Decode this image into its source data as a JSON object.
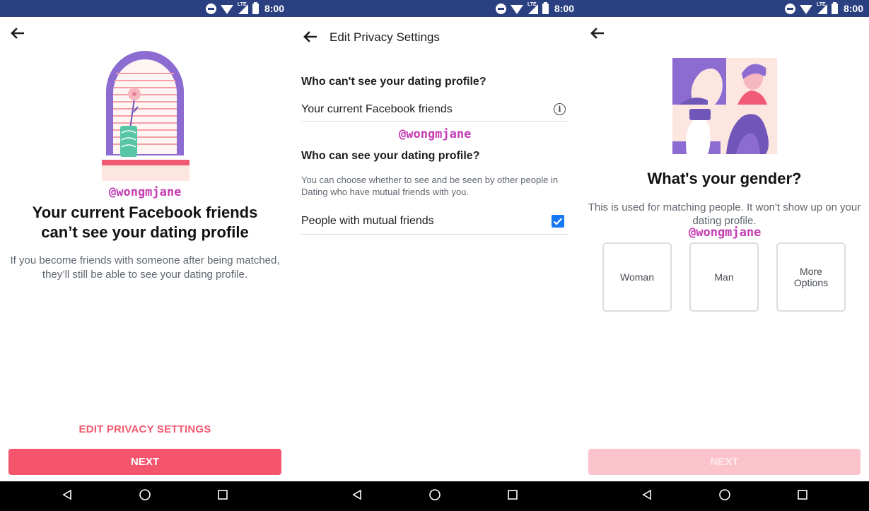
{
  "status_bar": {
    "time": "8:00",
    "network": "LTE"
  },
  "screen1": {
    "headline_line1": "Your current Facebook friends",
    "headline_line2": "can’t see your dating profile",
    "subtext": "If you become friends with someone after being matched, they’ll still be able to see your dating profile.",
    "edit_link": "EDIT PRIVACY SETTINGS",
    "next_button": "NEXT",
    "watermark": "@wongmjane"
  },
  "screen2": {
    "title": "Edit Privacy Settings",
    "section1_heading": "Who can't see your dating profile?",
    "section1_row": "Your current Facebook friends",
    "section2_heading": "Who can see your dating profile?",
    "section2_desc": "You can choose whether to see and be seen by other people in Dating who have mutual friends with you.",
    "section2_row": "People with mutual friends",
    "mutual_friends_checked": true,
    "watermark": "@wongmjane"
  },
  "screen3": {
    "headline": "What's your gender?",
    "subtext": "This is used for matching people. It won't show up on your dating profile.",
    "options": [
      "Woman",
      "Man",
      "More Options"
    ],
    "next_button": "NEXT",
    "next_enabled": false,
    "watermark": "@wongmjane"
  },
  "colors": {
    "accent": "#f5546d",
    "status_bar": "#2b4080",
    "checkbox": "#1877f2",
    "watermark": "#c43bb3"
  }
}
